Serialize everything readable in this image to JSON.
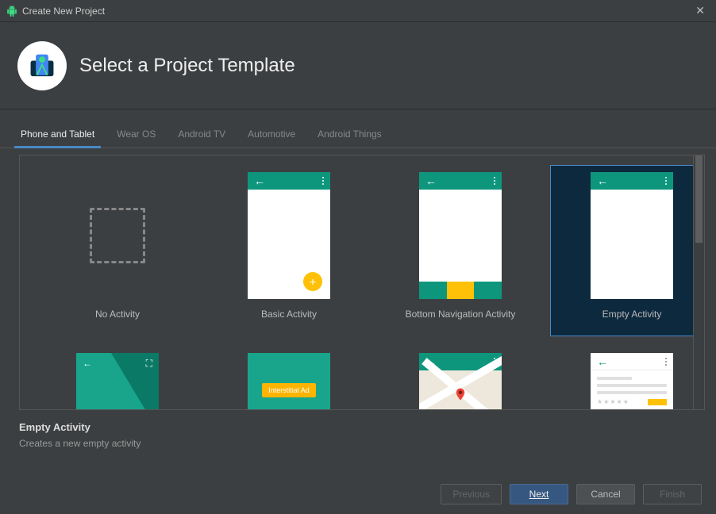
{
  "titlebar": {
    "title": "Create New Project"
  },
  "header": {
    "title": "Select a Project Template"
  },
  "tabs": [
    {
      "label": "Phone and Tablet",
      "active": true
    },
    {
      "label": "Wear OS",
      "active": false
    },
    {
      "label": "Android TV",
      "active": false
    },
    {
      "label": "Automotive",
      "active": false
    },
    {
      "label": "Android Things",
      "active": false
    }
  ],
  "templates_row1": [
    {
      "label": "No Activity",
      "type": "none",
      "selected": false
    },
    {
      "label": "Basic Activity",
      "type": "basic",
      "selected": false
    },
    {
      "label": "Bottom Navigation Activity",
      "type": "bottomnav",
      "selected": false
    },
    {
      "label": "Empty Activity",
      "type": "empty",
      "selected": true
    }
  ],
  "templates_row2": [
    {
      "type": "fullscreen"
    },
    {
      "type": "interstitial",
      "badge": "Interstitial Ad"
    },
    {
      "type": "maps"
    },
    {
      "type": "detail"
    }
  ],
  "info": {
    "title": "Empty Activity",
    "desc": "Creates a new empty activity"
  },
  "buttons": {
    "previous": "Previous",
    "next": "Next",
    "cancel": "Cancel",
    "finish": "Finish"
  }
}
